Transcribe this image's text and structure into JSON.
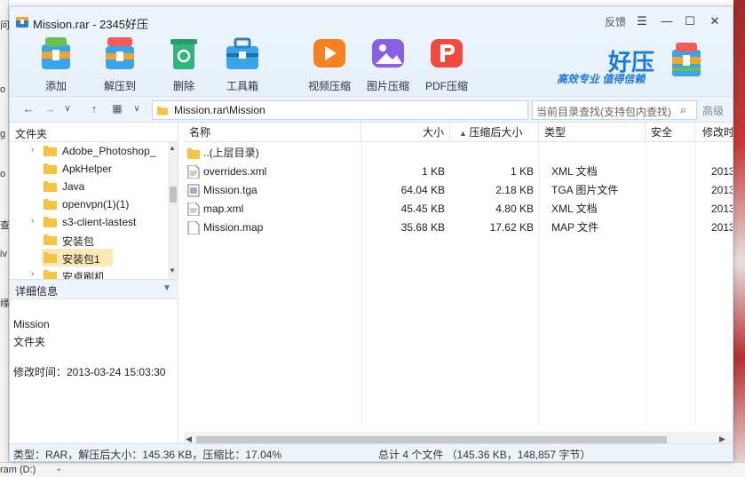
{
  "window": {
    "title": "Mission.rar - 2345好压",
    "feedback": "反馈",
    "controls": {
      "menu": "☰",
      "minimize": "—",
      "maximize": "☐",
      "close": "✕"
    }
  },
  "toolbar": [
    {
      "label": "添加",
      "icon": "add-archive-icon"
    },
    {
      "label": "解压到",
      "icon": "extract-icon"
    },
    {
      "label": "删除",
      "icon": "recycle-icon"
    },
    {
      "label": "工具箱",
      "icon": "toolbox-icon"
    },
    {
      "label": "视频压缩",
      "icon": "video-compress-icon"
    },
    {
      "label": "图片压缩",
      "icon": "image-compress-icon"
    },
    {
      "label": "PDF压缩",
      "icon": "pdf-compress-icon"
    }
  ],
  "brand": {
    "name": "好压",
    "slogan": "高效专业  值得信赖"
  },
  "address": {
    "path": "Mission.rar\\Mission",
    "search_placeholder": "当前目录查找(支持包内查找)",
    "advanced": "高级"
  },
  "tree": {
    "header": "文件夹",
    "items": [
      {
        "label": "Adobe_Photoshop_",
        "expandable": true
      },
      {
        "label": "ApkHelper",
        "expandable": false
      },
      {
        "label": "Java",
        "expandable": false
      },
      {
        "label": "openvpn(1)(1)",
        "expandable": false
      },
      {
        "label": "s3-client-lastest",
        "expandable": true
      },
      {
        "label": "安装包",
        "expandable": false
      },
      {
        "label": "安装包1",
        "expandable": false,
        "selected": true
      },
      {
        "label": "安卓刷机",
        "expandable": true
      }
    ]
  },
  "details": {
    "header": "详细信息",
    "name": "Mission",
    "type": "文件夹",
    "modified": "修改时间：2013-03-24 15:03:30"
  },
  "list": {
    "columns": {
      "name": "名称",
      "size": "大小",
      "packed": "压缩后大小",
      "type": "类型",
      "security": "安全",
      "modified": "修改时"
    },
    "rows": [
      {
        "name": "..(上层目录)",
        "size": "",
        "packed": "",
        "type": "",
        "modified": "",
        "icon": "folder-up-icon"
      },
      {
        "name": "overrides.xml",
        "size": "1 KB",
        "packed": "1 KB",
        "type": "XML 文档",
        "modified": "2013-",
        "icon": "xml-file-icon"
      },
      {
        "name": "Mission.tga",
        "size": "64.04 KB",
        "packed": "2.18 KB",
        "type": "TGA 图片文件",
        "modified": "2013-",
        "icon": "image-file-icon"
      },
      {
        "name": "map.xml",
        "size": "45.45 KB",
        "packed": "4.80 KB",
        "type": "XML 文档",
        "modified": "2013-",
        "icon": "xml-file-icon"
      },
      {
        "name": "Mission.map",
        "size": "35.68 KB",
        "packed": "17.62 KB",
        "type": "MAP 文件",
        "modified": "2013-",
        "icon": "generic-file-icon"
      }
    ]
  },
  "status": {
    "left": "类型：RAR，解压后大小：145.36 KB，压缩比：17.04%",
    "right": "总计 4 个文件 （145.36 KB，148,857 字节）"
  },
  "background": {
    "drive": "ram (D:)",
    "edge_glyphs": [
      "问",
      "o",
      "g",
      "o",
      "查",
      "iv",
      "缘"
    ]
  },
  "colors": {
    "accent": "#1a7ae0",
    "selected_row": "#fde9b8",
    "titlebar": "#eaf3fc"
  }
}
